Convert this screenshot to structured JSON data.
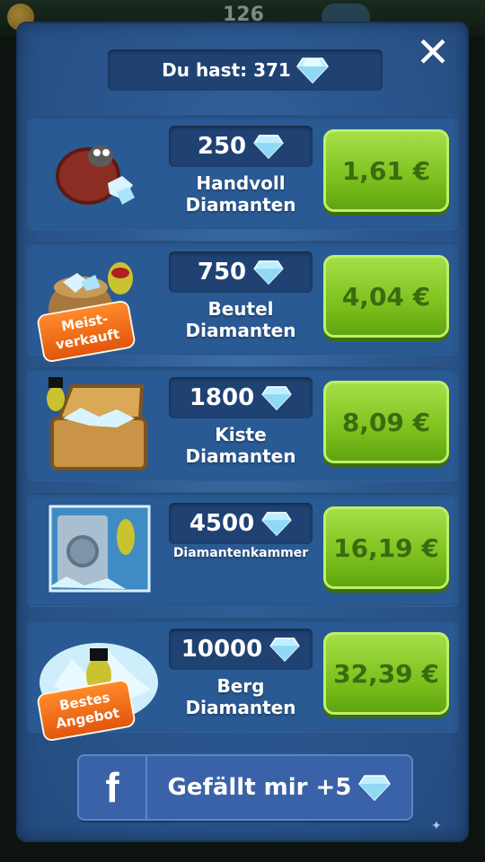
{
  "header": {
    "top_count": "126"
  },
  "balance": {
    "label": "Du hast: 371"
  },
  "offers": [
    {
      "amount": "250",
      "name_line1": "Handvoll",
      "name_line2": "Diamanten",
      "price": "1,61 €",
      "badge": ""
    },
    {
      "amount": "750",
      "name_line1": "Beutel",
      "name_line2": "Diamanten",
      "price": "4,04 €",
      "badge": "Meist-\nverkauft"
    },
    {
      "amount": "1800",
      "name_line1": "Kiste",
      "name_line2": "Diamanten",
      "price": "8,09 €",
      "badge": ""
    },
    {
      "amount": "4500",
      "name_line1": "Diamantenkammer",
      "name_line2": "",
      "price": "16,19 €",
      "badge": ""
    },
    {
      "amount": "10000",
      "name_line1": "Berg",
      "name_line2": "Diamanten",
      "price": "32,39 €",
      "badge": "Bestes\nAngebot"
    }
  ],
  "facebook": {
    "icon_letter": "f",
    "label": "Gefällt mir +5"
  },
  "icons": {
    "currency": "diamond-icon",
    "close": "close-icon"
  },
  "colors": {
    "panel": "#2c5890",
    "price_button": "#7cc11d",
    "badge": "#e2560c",
    "facebook": "#3a62a8"
  }
}
